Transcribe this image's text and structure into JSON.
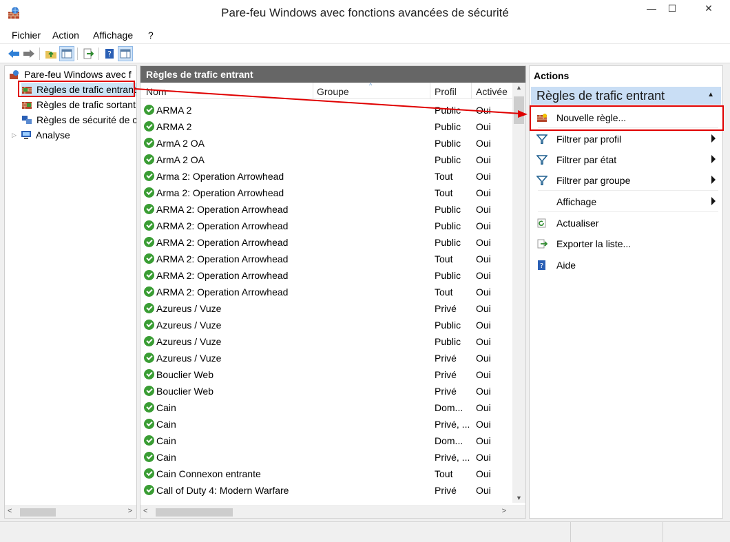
{
  "window": {
    "title": "Pare-feu Windows avec fonctions avancées de sécurité",
    "min_glyph": "—",
    "max_glyph": "☐",
    "close_glyph": "✕"
  },
  "menu": {
    "items": [
      "Fichier",
      "Action",
      "Affichage",
      "?"
    ]
  },
  "toolbar": {
    "icons": [
      "back-arrow-icon",
      "forward-arrow-icon",
      "up-folder-icon",
      "show-hide-tree-icon",
      "export-icon",
      "help-icon",
      "action-pane-icon"
    ]
  },
  "tree": {
    "items": [
      {
        "label": "Pare-feu Windows avec f",
        "icon": "firewall-icon"
      },
      {
        "label": "Règles de trafic entrant",
        "icon": "inbound-rules-icon"
      },
      {
        "label": "Règles de trafic sortant",
        "icon": "outbound-rules-icon"
      },
      {
        "label": "Règles de sécurité de c",
        "icon": "connection-security-icon"
      },
      {
        "label": "Analyse",
        "icon": "monitoring-icon",
        "expander": "▷"
      }
    ]
  },
  "center": {
    "header": "Règles de trafic entrant",
    "columns": {
      "nom": "Nom",
      "groupe": "Groupe",
      "profil": "Profil",
      "activee": "Activée"
    },
    "rows": [
      {
        "nom": "ARMA 2",
        "profil": "Public",
        "activee": "Oui"
      },
      {
        "nom": "ARMA 2",
        "profil": "Public",
        "activee": "Oui"
      },
      {
        "nom": "ArmA 2 OA",
        "profil": "Public",
        "activee": "Oui"
      },
      {
        "nom": "ArmA 2 OA",
        "profil": "Public",
        "activee": "Oui"
      },
      {
        "nom": "Arma 2: Operation Arrowhead",
        "profil": "Tout",
        "activee": "Oui"
      },
      {
        "nom": "Arma 2: Operation Arrowhead",
        "profil": "Tout",
        "activee": "Oui"
      },
      {
        "nom": "ARMA 2: Operation Arrowhead",
        "profil": "Public",
        "activee": "Oui"
      },
      {
        "nom": "ARMA 2: Operation Arrowhead",
        "profil": "Public",
        "activee": "Oui"
      },
      {
        "nom": "ARMA 2: Operation Arrowhead",
        "profil": "Public",
        "activee": "Oui"
      },
      {
        "nom": "ARMA 2: Operation Arrowhead",
        "profil": "Tout",
        "activee": "Oui"
      },
      {
        "nom": "ARMA 2: Operation Arrowhead",
        "profil": "Public",
        "activee": "Oui"
      },
      {
        "nom": "ARMA 2: Operation Arrowhead",
        "profil": "Tout",
        "activee": "Oui"
      },
      {
        "nom": "Azureus / Vuze",
        "profil": "Privé",
        "activee": "Oui"
      },
      {
        "nom": "Azureus / Vuze",
        "profil": "Public",
        "activee": "Oui"
      },
      {
        "nom": "Azureus / Vuze",
        "profil": "Public",
        "activee": "Oui"
      },
      {
        "nom": "Azureus / Vuze",
        "profil": "Privé",
        "activee": "Oui"
      },
      {
        "nom": "Bouclier Web",
        "profil": "Privé",
        "activee": "Oui"
      },
      {
        "nom": "Bouclier Web",
        "profil": "Privé",
        "activee": "Oui"
      },
      {
        "nom": "Cain",
        "profil": "Dom...",
        "activee": "Oui"
      },
      {
        "nom": "Cain",
        "profil": "Privé, ...",
        "activee": "Oui"
      },
      {
        "nom": "Cain",
        "profil": "Dom...",
        "activee": "Oui"
      },
      {
        "nom": "Cain",
        "profil": "Privé, ...",
        "activee": "Oui"
      },
      {
        "nom": "Cain Connexon entrante",
        "profil": "Tout",
        "activee": "Oui"
      },
      {
        "nom": "Call of Duty 4: Modern Warfare",
        "profil": "Privé",
        "activee": "Oui"
      }
    ]
  },
  "actions": {
    "title": "Actions",
    "section": "Règles de trafic entrant",
    "section_glyph": "▲",
    "items": [
      {
        "label": "Nouvelle règle...",
        "icon": "new-rule-icon",
        "submenu": false
      },
      {
        "label": "Filtrer par profil",
        "icon": "filter-icon",
        "submenu": true
      },
      {
        "label": "Filtrer par état",
        "icon": "filter-icon",
        "submenu": true
      },
      {
        "label": "Filtrer par groupe",
        "icon": "filter-icon",
        "submenu": true
      },
      {
        "label": "Affichage",
        "icon": "",
        "submenu": true
      },
      {
        "label": "Actualiser",
        "icon": "refresh-icon",
        "submenu": false
      },
      {
        "label": "Exporter la liste...",
        "icon": "export-list-icon",
        "submenu": false
      },
      {
        "label": "Aide",
        "icon": "help-icon",
        "submenu": false
      }
    ]
  },
  "colors": {
    "annotation_red": "#e00000",
    "section_blue": "#c9def5",
    "header_gray": "#666666",
    "enabled_green": "#3a9d34"
  }
}
